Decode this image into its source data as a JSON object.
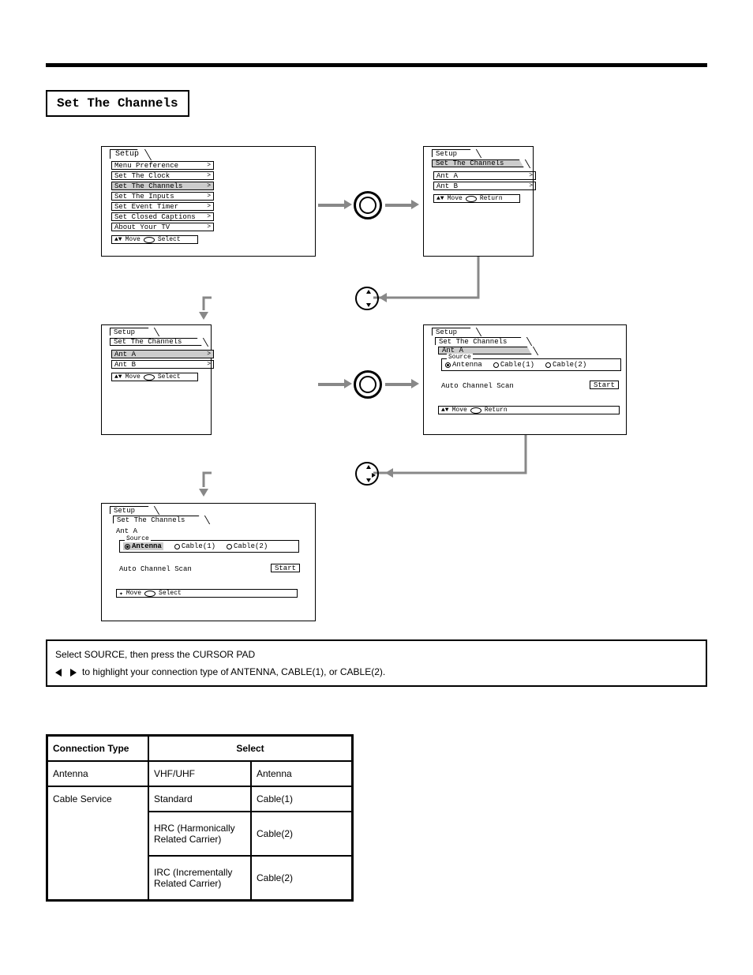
{
  "page_heading": "Set The Channels",
  "panels": {
    "setup_label": "Setup",
    "set_channels_label": "Set The Channels",
    "ant_a_label": "Ant A",
    "ant_b_label": "Ant B",
    "menu_items": [
      "Menu Preference",
      "Set The Clock",
      "Set The Channels",
      "Set The Inputs",
      "Set Event Timer",
      "Set Closed Captions",
      "About Your TV"
    ],
    "hint_move": "Move",
    "hint_select": "Select",
    "hint_return": "Return",
    "source_label": "Source",
    "opt_antenna": "Antenna",
    "opt_cable1": "Cable(1)",
    "opt_cable2": "Cable(2)",
    "auto_scan": "Auto Channel Scan",
    "start": "Start"
  },
  "instructions": {
    "line1": "Select SOURCE, then press the CURSOR PAD",
    "line2_suffix": "to highlight your connection type of ANTENNA, CABLE(1), or CABLE(2)."
  },
  "table": {
    "hdr_connection": "Connection Type",
    "hdr_select": "Select",
    "r1c1": "Antenna",
    "r1c2": "VHF/UHF",
    "r1c3": "Antenna",
    "r2c1": "Cable Service",
    "r2a2": "Standard",
    "r2a3": "Cable(1)",
    "r2b2": "HRC (Harmonically Related Carrier)",
    "r2b3": "Cable(2)",
    "r2c2": "IRC (Incrementally Related Carrier)",
    "r2c3": "Cable(2)"
  }
}
